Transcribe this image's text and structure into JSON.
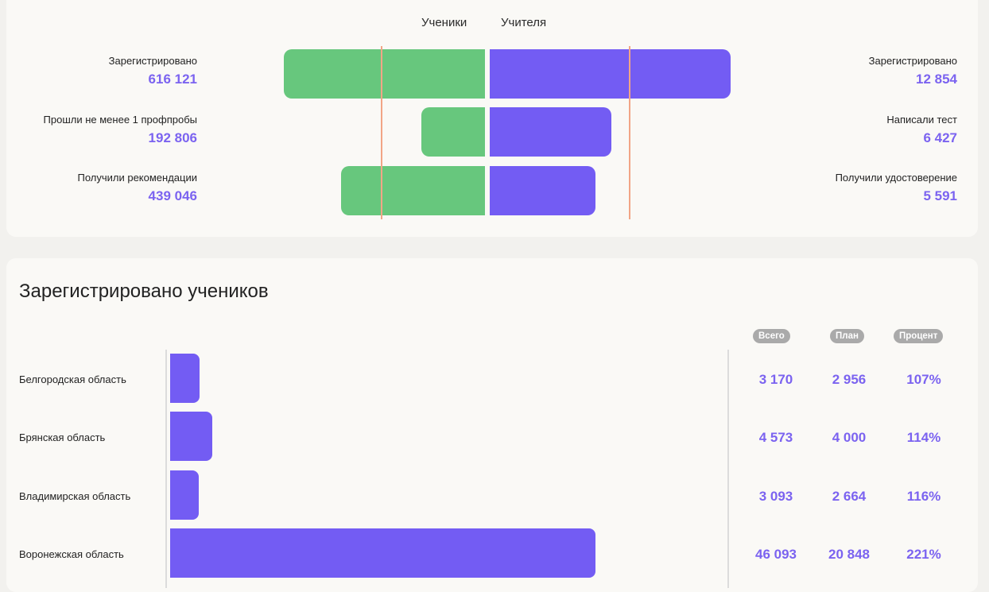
{
  "funnel": {
    "tabs": {
      "students": "Ученики",
      "teachers": "Учителя"
    },
    "students": [
      {
        "label": "Зарегистрировано",
        "value": "616 121"
      },
      {
        "label": "Прошли не менее 1 профпробы",
        "value": "192 806"
      },
      {
        "label": "Получили рекомендации",
        "value": "439 046"
      }
    ],
    "teachers": [
      {
        "label": "Зарегистрировано",
        "value": "12 854"
      },
      {
        "label": "Написали тест",
        "value": "6 427"
      },
      {
        "label": "Получили удостоверение",
        "value": "5 591"
      }
    ],
    "colors": {
      "students": "#67c77d",
      "teachers": "#735cf3",
      "marker": "#f2a586"
    }
  },
  "registered": {
    "title": "Зарегистрировано учеников",
    "columns": {
      "total": "Всего",
      "plan": "План",
      "percent": "Процент"
    },
    "rows": [
      {
        "region": "Белгородская область",
        "total": "3 170",
        "plan": "2 956",
        "percent": "107%"
      },
      {
        "region": "Брянская область",
        "total": "4 573",
        "plan": "4 000",
        "percent": "114%"
      },
      {
        "region": "Владимирская область",
        "total": "3 093",
        "plan": "2 664",
        "percent": "116%"
      },
      {
        "region": "Воронежская область",
        "total": "46 093",
        "plan": "20 848",
        "percent": "221%"
      }
    ],
    "bar_color": "#735cf3"
  }
}
